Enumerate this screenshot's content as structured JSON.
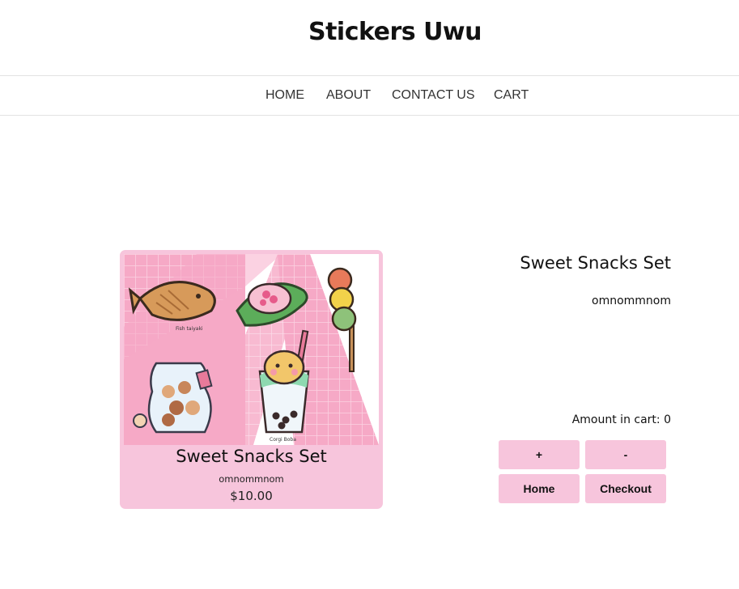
{
  "site": {
    "title": "Stickers Uwu"
  },
  "nav": {
    "items": [
      {
        "label": "HOME"
      },
      {
        "label": "ABOUT"
      },
      {
        "label": "CONTACT US"
      },
      {
        "label": "CART"
      }
    ]
  },
  "product_card": {
    "title": "Sweet Snacks Set",
    "author": "omnommnom",
    "price": "$10.00",
    "image_labels": {
      "taiyaki": "Fish taiyaki",
      "mochi": "Sakura Mochi",
      "dango": "Dango",
      "cookies": "Bear Cookies",
      "boba": "Corgi Boba"
    }
  },
  "product_detail": {
    "title": "Sweet Snacks Set",
    "author": "omnommnom",
    "amount_label": "Amount in cart: 0"
  },
  "buttons": {
    "plus": "+",
    "minus": "-",
    "home": "Home",
    "checkout": "Checkout"
  },
  "colors": {
    "accent_pink": "#f7c5dc",
    "sticker_pink": "#f6a9c6"
  }
}
